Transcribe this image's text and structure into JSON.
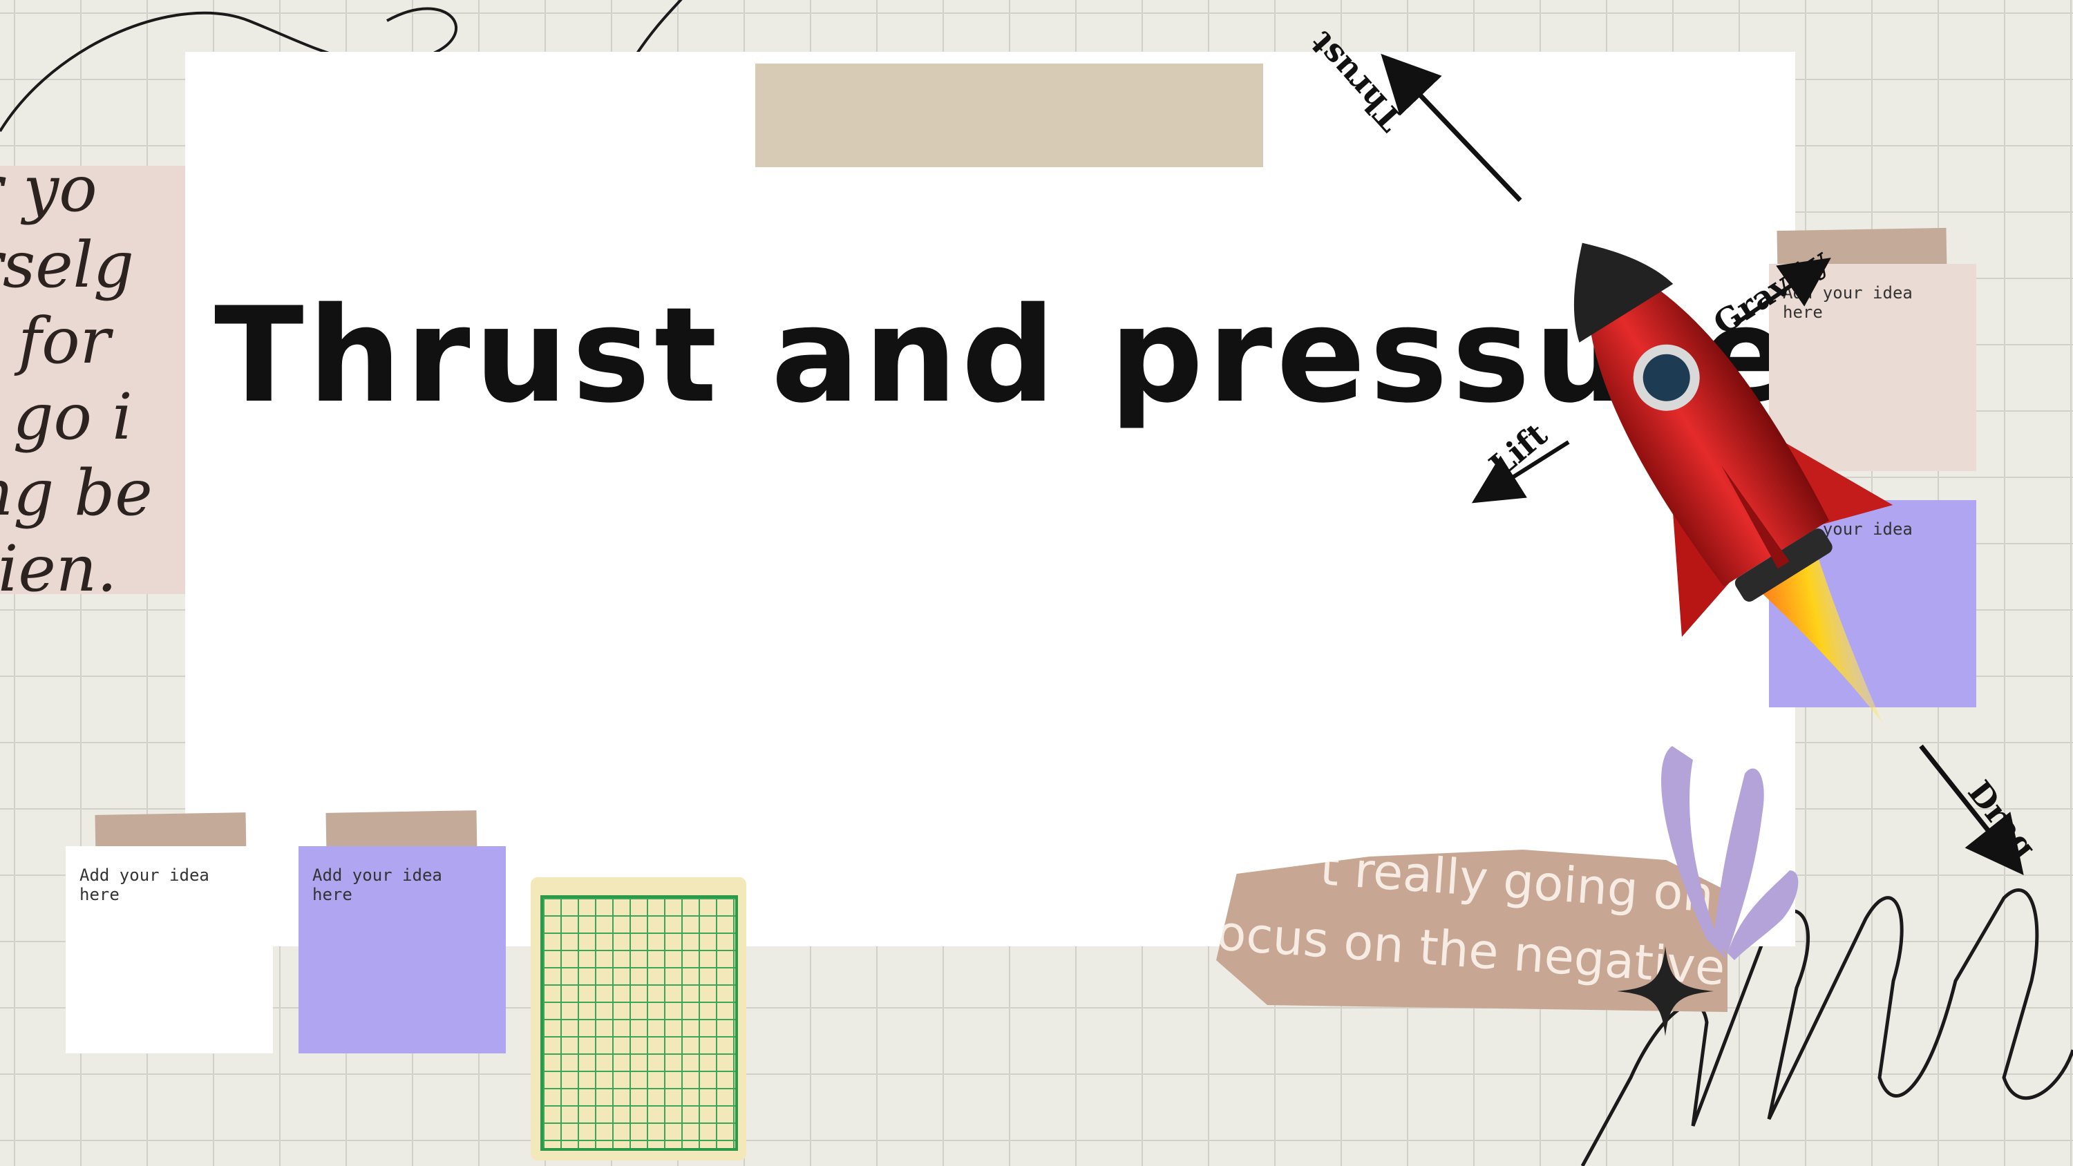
{
  "slide": {
    "title": "Thrust and pressure"
  },
  "sticky_notes": [
    {
      "id": "note-1",
      "text": "Add your idea here",
      "color": "#ffffff"
    },
    {
      "id": "note-2",
      "text": "Add your idea here",
      "color": "#b0a5f0"
    },
    {
      "id": "note-3",
      "text": "Add your idea here",
      "color": "#eadbd4"
    },
    {
      "id": "note-4",
      "text": "Add your idea here",
      "color": "#b0a5f0"
    }
  ],
  "diagram": {
    "forces": {
      "thrust": "Thrust",
      "gravity": "Gravity",
      "lift": "Lift",
      "drag": "Drag"
    }
  },
  "decor": {
    "script_lines": [
      "r yo",
      "rselg",
      "t for",
      "l go i",
      "ng be",
      "tien."
    ],
    "quote_lines": [
      "t really going on",
      "ocus on the negative"
    ]
  },
  "colors": {
    "background": "#ecebe4",
    "paper": "#ffffff",
    "purple_note": "#b0a5f0",
    "tape": "#c4aa98",
    "rocket_red": "#d21f1f"
  }
}
